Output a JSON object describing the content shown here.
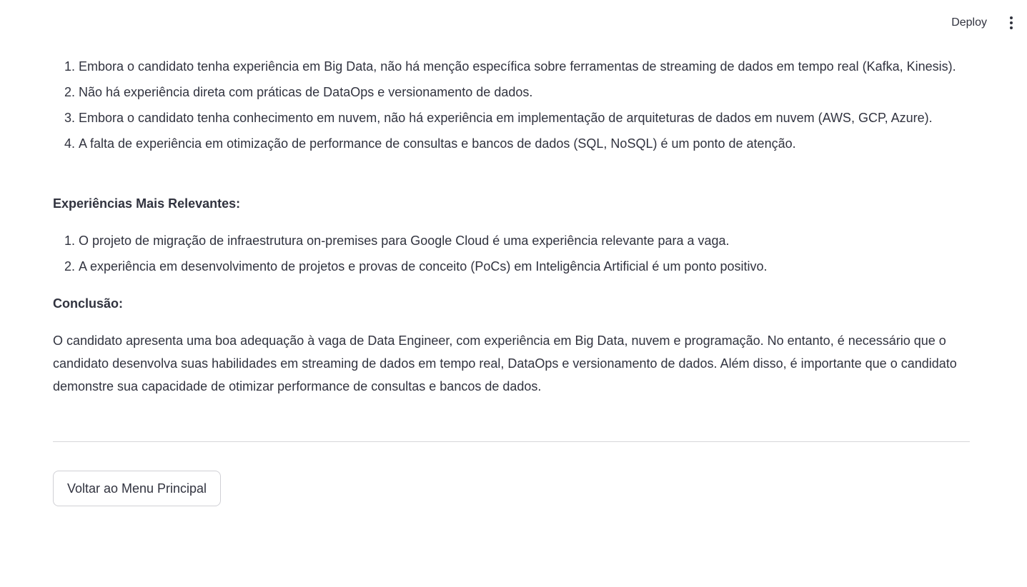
{
  "header": {
    "deploy_label": "Deploy",
    "menu_icon": "vertical-ellipsis-icon"
  },
  "weaknesses": [
    "Embora o candidato tenha experiência em Big Data, não há menção específica sobre ferramentas de streaming de dados em tempo real (Kafka, Kinesis).",
    "Não há experiência direta com práticas de DataOps e versionamento de dados.",
    "Embora o candidato tenha conhecimento em nuvem, não há experiência em implementação de arquiteturas de dados em nuvem (AWS, GCP, Azure).",
    "A falta de experiência em otimização de performance de consultas e bancos de dados (SQL, NoSQL) é um ponto de atenção."
  ],
  "relevant": {
    "heading": "Experiências Mais Relevantes:",
    "items": [
      "O projeto de migração de infraestrutura on-premises para Google Cloud é uma experiência relevante para a vaga.",
      "A experiência em desenvolvimento de projetos e provas de conceito (PoCs) em Inteligência Artificial é um ponto positivo."
    ]
  },
  "conclusion": {
    "heading": "Conclusão:",
    "text": "O candidato apresenta uma boa adequação à vaga de Data Engineer, com experiência em Big Data, nuvem e programação. No entanto, é necessário que o candidato desenvolva suas habilidades em streaming de dados em tempo real, DataOps e versionamento de dados. Além disso, é importante que o candidato demonstre sua capacidade de otimizar performance de consultas e bancos de dados."
  },
  "actions": {
    "back_label": "Voltar ao Menu Principal"
  }
}
